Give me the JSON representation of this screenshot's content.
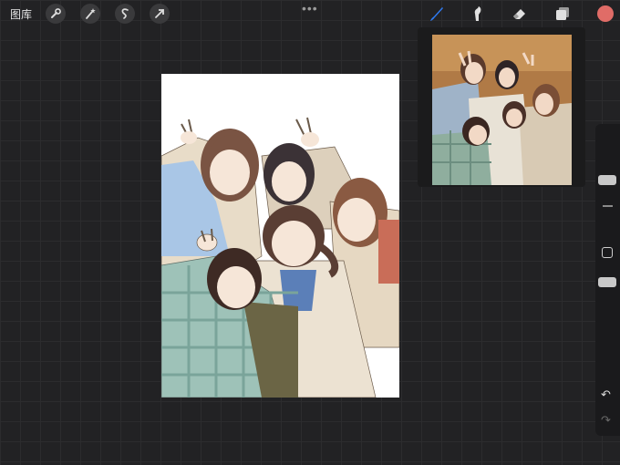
{
  "topbar": {
    "gallery_label": "图库",
    "left_tools": [
      "wrench-icon",
      "magic-wand-icon",
      "selection-icon",
      "transform-icon"
    ],
    "menu_dots": "•••",
    "right_tools": [
      "brush-icon",
      "smudge-icon",
      "eraser-icon",
      "layers-icon"
    ],
    "active_tool": "brush-icon",
    "current_color": "#e06c67",
    "accent_color": "#2f7df6"
  },
  "canvas": {
    "background": "#ffffff"
  },
  "reference": {
    "window": "reference-photo"
  },
  "sidebar": {
    "undo": "↶",
    "redo": "↷"
  }
}
